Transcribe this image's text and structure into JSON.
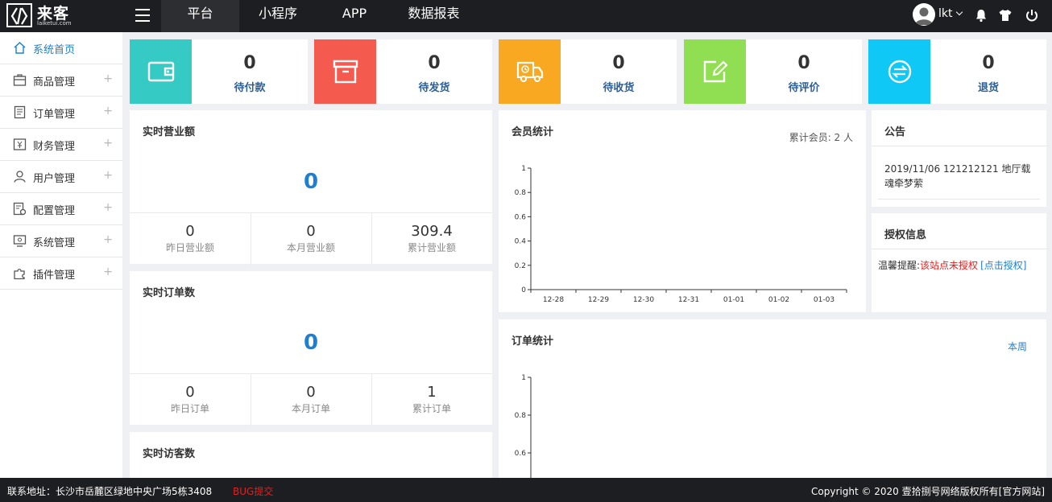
{
  "brand": {
    "name": "来客",
    "domain": "laiketui.com"
  },
  "topnav": [
    {
      "label": "平台"
    },
    {
      "label": "小程序"
    },
    {
      "label": "APP"
    },
    {
      "label": "数据报表"
    }
  ],
  "user": {
    "name": "lkt"
  },
  "sidebar": {
    "items": [
      {
        "label": "系统首页",
        "icon": "home-icon"
      },
      {
        "label": "商品管理",
        "icon": "box-icon"
      },
      {
        "label": "订单管理",
        "icon": "document-icon"
      },
      {
        "label": "财务管理",
        "icon": "yen-icon"
      },
      {
        "label": "用户管理",
        "icon": "user-icon"
      },
      {
        "label": "配置管理",
        "icon": "config-icon"
      },
      {
        "label": "系统管理",
        "icon": "monitor-icon"
      },
      {
        "label": "插件管理",
        "icon": "puzzle-icon"
      }
    ],
    "plus": "+"
  },
  "stats": [
    {
      "value": "0",
      "label": "待付款",
      "color": "#35cbc4",
      "icon": "wallet-icon"
    },
    {
      "value": "0",
      "label": "待发货",
      "color": "#f55a4e",
      "icon": "archive-icon"
    },
    {
      "value": "0",
      "label": "待收货",
      "color": "#f8a821",
      "icon": "truck-icon"
    },
    {
      "value": "0",
      "label": "待评价",
      "color": "#90de51",
      "icon": "edit-icon"
    },
    {
      "value": "0",
      "label": "退货",
      "color": "#10c8f5",
      "icon": "return-icon"
    }
  ],
  "revenue": {
    "title": "实时营业额",
    "value": "0",
    "cells": [
      {
        "value": "0",
        "label": "昨日营业额"
      },
      {
        "value": "0",
        "label": "本月营业额"
      },
      {
        "value": "309.4",
        "label": "累计营业额"
      }
    ]
  },
  "orders_panel": {
    "title": "实时订单数",
    "value": "0",
    "cells": [
      {
        "value": "0",
        "label": "昨日订单"
      },
      {
        "value": "0",
        "label": "本月订单"
      },
      {
        "value": "1",
        "label": "累计订单"
      }
    ]
  },
  "visitors": {
    "title": "实时访客数"
  },
  "members": {
    "title": "会员统计",
    "total_text": "累计会员: 2 人"
  },
  "order_stats": {
    "title": "订单统计",
    "period": "本周"
  },
  "notice": {
    "title": "公告",
    "text": "2019/11/06 121212121 地厅载魂牵梦萦"
  },
  "license": {
    "title": "授权信息",
    "prefix": "温馨提醒:",
    "warning": "该站点未授权",
    "link": "[点击授权]"
  },
  "footer": {
    "address": "联系地址：长沙市岳麓区绿地中央广场5栋3408",
    "bug": "BUG提交",
    "copyright": "Copyright © 2020 壹拾捌号网络版权所有[官方网站]"
  },
  "chart_data": [
    {
      "type": "line",
      "title": "会员统计",
      "categories": [
        "12-28",
        "12-29",
        "12-30",
        "12-31",
        "01-01",
        "01-02",
        "01-03"
      ],
      "values": [
        0,
        0,
        0,
        0,
        0,
        0,
        0
      ],
      "ylim": [
        0,
        1
      ],
      "yticks": [
        "0",
        "0.2",
        "0.4",
        "0.6",
        "0.8",
        "1"
      ]
    },
    {
      "type": "line",
      "title": "订单统计",
      "categories": [],
      "values": [],
      "ylim": [
        0,
        1
      ],
      "yticks": [
        "0.6",
        "0.8",
        "1"
      ]
    }
  ]
}
